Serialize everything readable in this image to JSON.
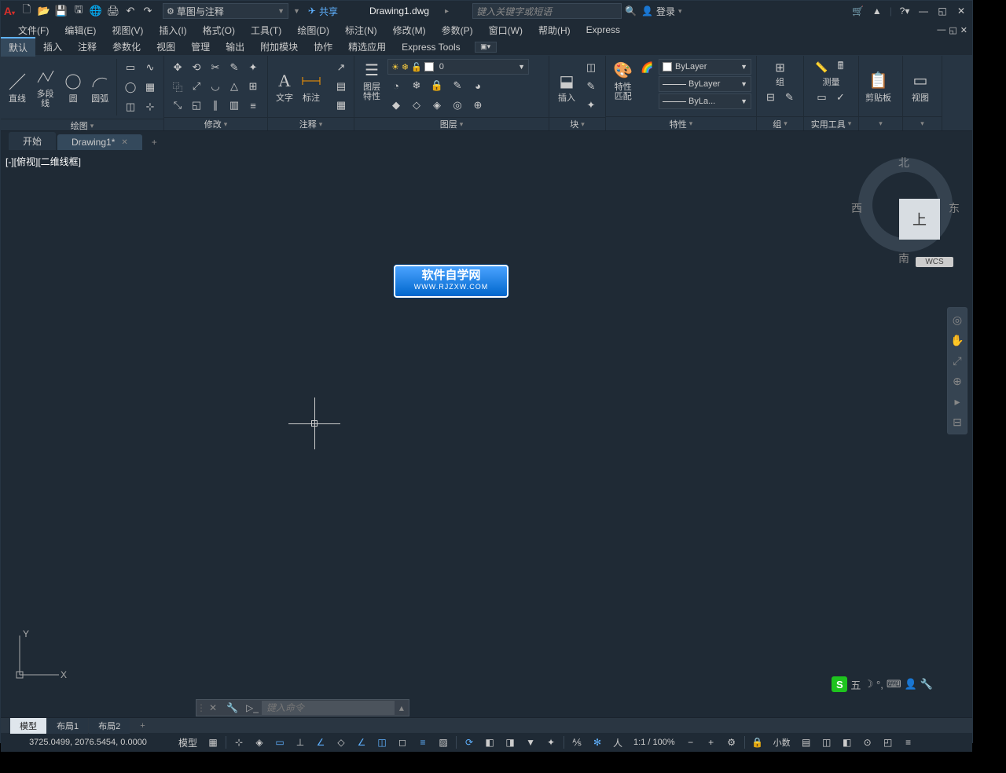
{
  "title": {
    "workspace": "草图与注释",
    "share": "共享",
    "document": "Drawing1.dwg",
    "search_placeholder": "键入关键字或短语",
    "login": "登录"
  },
  "menus": [
    "文件(F)",
    "编辑(E)",
    "视图(V)",
    "插入(I)",
    "格式(O)",
    "工具(T)",
    "绘图(D)",
    "标注(N)",
    "修改(M)",
    "参数(P)",
    "窗口(W)",
    "帮助(H)",
    "Express"
  ],
  "ribtabs": [
    "默认",
    "插入",
    "注释",
    "参数化",
    "视图",
    "管理",
    "输出",
    "附加模块",
    "协作",
    "精选应用",
    "Express Tools"
  ],
  "panels": {
    "draw": {
      "title": "绘图",
      "line": "直线",
      "pline": "多段线",
      "circle": "圆",
      "arc": "圆弧"
    },
    "modify": {
      "title": "修改"
    },
    "annot": {
      "title": "注释",
      "text": "文字",
      "dim": "标注"
    },
    "layer": {
      "title": "图层",
      "props": "图层\n特性",
      "layer0": "0"
    },
    "block": {
      "title": "块",
      "insert": "插入"
    },
    "props": {
      "title": "特性",
      "match": "特性\n匹配",
      "bylayer": "ByLayer",
      "bylayer2": "ByLayer",
      "bylayer3": "ByLa..."
    },
    "group": {
      "title": "组",
      "group": "组"
    },
    "util": {
      "title": "实用工具",
      "measure": "测量"
    },
    "clip": {
      "title": "",
      "clip": "剪贴板"
    },
    "view": {
      "title": "",
      "view": "视图"
    }
  },
  "doctabs": {
    "start": "开始",
    "drawing": "Drawing1*"
  },
  "viewport": {
    "label": "[-][俯视][二维线框]"
  },
  "viewcube": {
    "top": "上",
    "n": "北",
    "s": "南",
    "e": "东",
    "w": "西",
    "wcs": "WCS"
  },
  "watermark": {
    "line1": "软件自学网",
    "line2": "WWW.RJZXW.COM"
  },
  "ime": {
    "label": "五"
  },
  "cmd": {
    "placeholder": "键入命令"
  },
  "laytabs": [
    "模型",
    "布局1",
    "布局2"
  ],
  "status": {
    "coords": "3725.0499, 2076.5454, 0.0000",
    "model": "模型",
    "scale": "1:1 / 100%",
    "dec": "小数"
  }
}
